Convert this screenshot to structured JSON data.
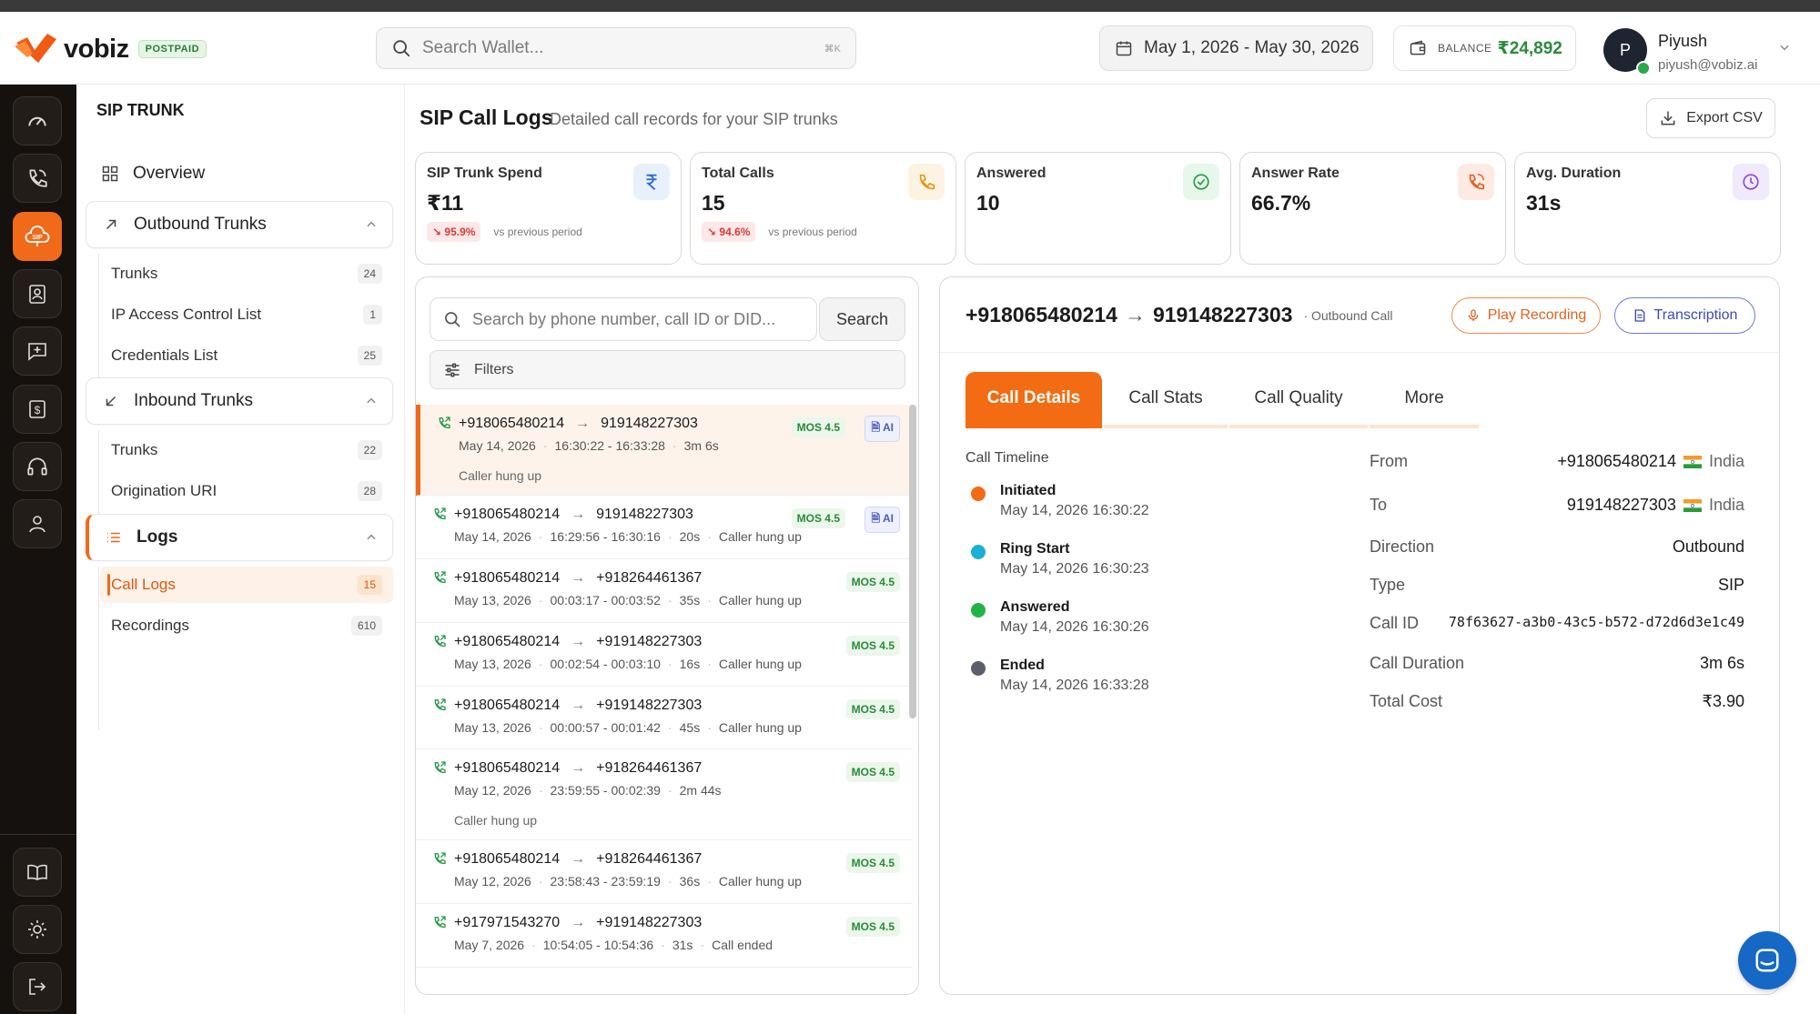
{
  "header": {
    "brand": "vobiz",
    "plan": "POSTPAID",
    "search_placeholder": "Search Wallet...",
    "search_shortcut": "⌘K",
    "date_range": "May 1, 2026 - May 30, 2026",
    "balance_label": "BALANCE",
    "balance_value": "₹24,892",
    "user_initial": "P",
    "user_name": "Piyush",
    "user_email": "piyush@vobiz.ai"
  },
  "rail": [
    "dashboard-icon",
    "phone-icon",
    "sip-icon",
    "contacts-icon",
    "message-icon",
    "billing-icon",
    "headset-icon",
    "user-icon",
    "book-icon",
    "sun-icon",
    "logout-icon"
  ],
  "sidebar": {
    "title": "SIP TRUNK",
    "overview": "Overview",
    "outbound": "Outbound Trunks",
    "outbound_items": [
      {
        "label": "Trunks",
        "count": "24"
      },
      {
        "label": "IP Access Control List",
        "count": "1"
      },
      {
        "label": "Credentials List",
        "count": "25"
      }
    ],
    "inbound": "Inbound Trunks",
    "inbound_items": [
      {
        "label": "Trunks",
        "count": "22"
      },
      {
        "label": "Origination URI",
        "count": "28"
      }
    ],
    "logs": "Logs",
    "logs_items": [
      {
        "label": "Call Logs",
        "count": "15"
      },
      {
        "label": "Recordings",
        "count": "610"
      }
    ]
  },
  "main": {
    "title": "SIP Call Logs",
    "subtitle": "Detailed call records for your SIP trunks",
    "export": "Export CSV"
  },
  "stats": [
    {
      "label": "SIP Trunk Spend",
      "value": "₹11",
      "change": "95.9%",
      "vs": "vs previous period",
      "icon": "rupee-icon",
      "color": "#2a6ad8",
      "bg": "#e8f0fc"
    },
    {
      "label": "Total Calls",
      "value": "15",
      "change": "94.6%",
      "vs": "vs previous period",
      "icon": "phone-icon",
      "color": "#e8961a",
      "bg": "#fdf3e3"
    },
    {
      "label": "Answered",
      "value": "10",
      "change": "",
      "vs": "",
      "icon": "check-circle-icon",
      "color": "#2a9a4a",
      "bg": "#e8f7ec"
    },
    {
      "label": "Answer Rate",
      "value": "66.7%",
      "change": "",
      "vs": "",
      "icon": "phone-ring-icon",
      "color": "#e0602a",
      "bg": "#fdebe3"
    },
    {
      "label": "Avg. Duration",
      "value": "31s",
      "change": "",
      "vs": "",
      "icon": "clock-icon",
      "color": "#8a4ad8",
      "bg": "#f1e9fc"
    }
  ],
  "list": {
    "search_placeholder": "Search by phone number, call ID or DID...",
    "search_button": "Search",
    "filters": "Filters",
    "rows": [
      {
        "from": "+918065480214",
        "to": "919148227303",
        "date": "May 14, 2026",
        "time": "16:30:22 - 16:33:28",
        "dur": "3m 6s",
        "reason": "Caller hung up",
        "mos": "MOS 4.5",
        "ai": "AI"
      },
      {
        "from": "+918065480214",
        "to": "919148227303",
        "date": "May 14, 2026",
        "time": "16:29:56 - 16:30:16",
        "dur": "20s",
        "reason": "Caller hung up",
        "mos": "MOS 4.5",
        "ai": "AI"
      },
      {
        "from": "+918065480214",
        "to": "+918264461367",
        "date": "May 13, 2026",
        "time": "00:03:17 - 00:03:52",
        "dur": "35s",
        "reason": "Caller hung up",
        "mos": "MOS 4.5",
        "ai": ""
      },
      {
        "from": "+918065480214",
        "to": "+919148227303",
        "date": "May 13, 2026",
        "time": "00:02:54 - 00:03:10",
        "dur": "16s",
        "reason": "Caller hung up",
        "mos": "MOS 4.5",
        "ai": ""
      },
      {
        "from": "+918065480214",
        "to": "+919148227303",
        "date": "May 13, 2026",
        "time": "00:00:57 - 00:01:42",
        "dur": "45s",
        "reason": "Caller hung up",
        "mos": "MOS 4.5",
        "ai": ""
      },
      {
        "from": "+918065480214",
        "to": "+918264461367",
        "date": "May 12, 2026",
        "time": "23:59:55 - 00:02:39",
        "dur": "2m 44s",
        "reason": "Caller hung up",
        "mos": "MOS 4.5",
        "ai": ""
      },
      {
        "from": "+918065480214",
        "to": "+918264461367",
        "date": "May 12, 2026",
        "time": "23:58:43 - 23:59:19",
        "dur": "36s",
        "reason": "Caller hung up",
        "mos": "MOS 4.5",
        "ai": ""
      },
      {
        "from": "+917971543270",
        "to": "+919148227303",
        "date": "May 7, 2026",
        "time": "10:54:05 - 10:54:36",
        "dur": "31s",
        "reason": "Call ended",
        "mos": "MOS 4.5",
        "ai": ""
      }
    ]
  },
  "detail": {
    "from": "+918065480214",
    "arrow": "→",
    "to": "919148227303",
    "direction_tag": "· Outbound Call",
    "play": "Play Recording",
    "transcription": "Transcription",
    "tabs": [
      "Call Details",
      "Call Stats",
      "Call Quality",
      "More"
    ],
    "timeline_title": "Call Timeline",
    "timeline": [
      {
        "title": "Initiated",
        "time": "May 14, 2026 16:30:22",
        "color": "#f36b12"
      },
      {
        "title": "Ring Start",
        "time": "May 14, 2026 16:30:23",
        "color": "#1ab0d8"
      },
      {
        "title": "Answered",
        "time": "May 14, 2026 16:30:26",
        "color": "#22b24a"
      },
      {
        "title": "Ended",
        "time": "May 14, 2026 16:33:28",
        "color": "#5a5f6a"
      }
    ],
    "fields": {
      "from_label": "From",
      "from_value": "+918065480214",
      "from_country": "India",
      "to_label": "To",
      "to_value": "919148227303",
      "to_country": "India",
      "direction_label": "Direction",
      "direction_value": "Outbound",
      "type_label": "Type",
      "type_value": "SIP",
      "callid_label": "Call ID",
      "callid_value": "78f63627-a3b0-43c5-b572-d72d6d3e1c49",
      "duration_label": "Call Duration",
      "duration_value": "3m 6s",
      "cost_label": "Total Cost",
      "cost_value": "₹3.90"
    }
  }
}
